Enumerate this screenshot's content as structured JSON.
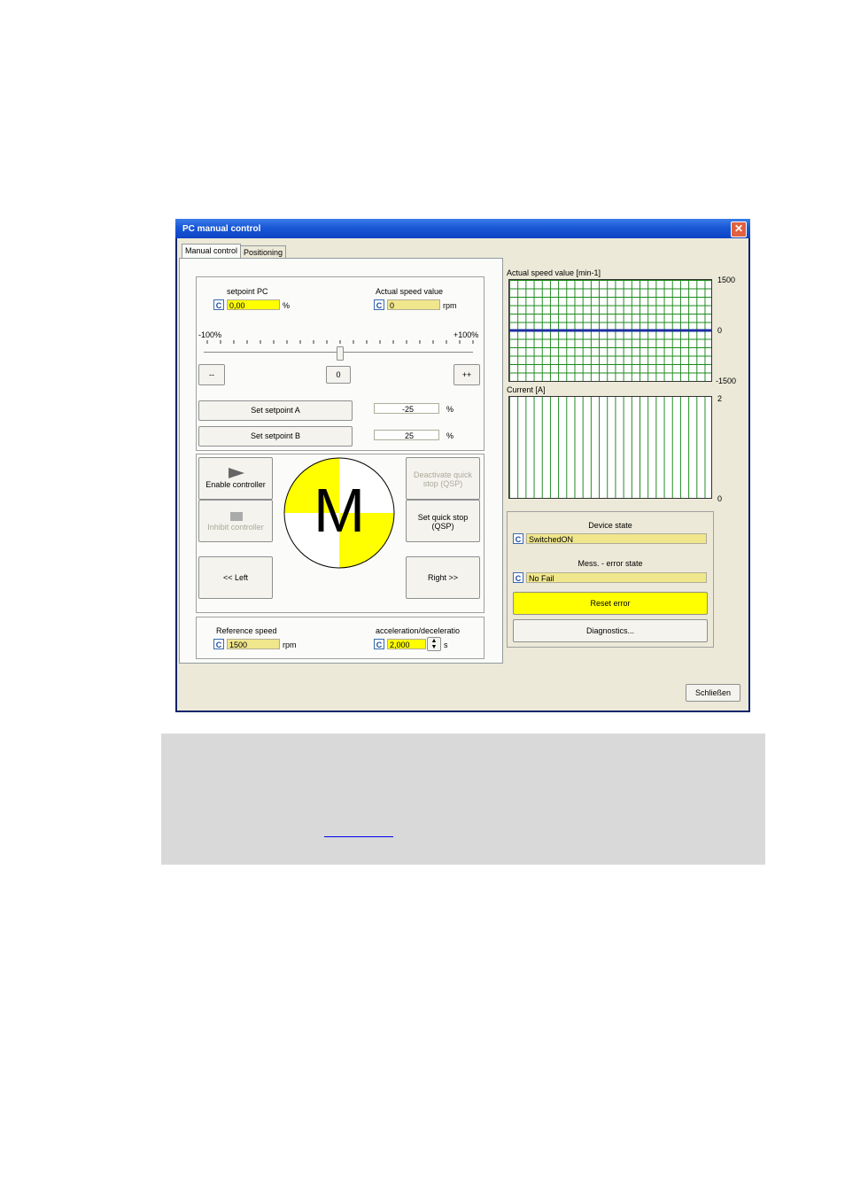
{
  "window": {
    "title": "PC manual control",
    "close": "✕"
  },
  "tabs": [
    {
      "label": "Manual control"
    },
    {
      "label": "Positioning"
    }
  ],
  "setpoint": {
    "label": "setpoint PC",
    "value": "0,00",
    "unit": "%",
    "actual_label": "Actual speed value",
    "actual_value": "0",
    "actual_unit": "rpm",
    "c": "C"
  },
  "slider": {
    "min_label": "-100%",
    "max_label": "+100%",
    "position_percent": 0
  },
  "step_buttons": {
    "minus": "--",
    "zero": "0",
    "plus": "++"
  },
  "set_setpoint_a": {
    "label": "Set setpoint A",
    "value": "-25",
    "unit": "%"
  },
  "set_setpoint_b": {
    "label": "Set setpoint B",
    "value": "25",
    "unit": "%"
  },
  "controls": {
    "enable": "Enable controller",
    "inhibit": "Inhibit controller",
    "deactivate_qsp": "Deactivate quick stop (QSP)",
    "set_qsp": "Set quick stop (QSP)",
    "left": "<< Left",
    "right": "Right >>",
    "motor_letter": "M"
  },
  "reference": {
    "speed_label": "Reference speed",
    "speed_value": "1500",
    "speed_unit": "rpm",
    "accel_label": "acceleration/deceleratio",
    "accel_value": "2,000",
    "accel_unit": "s"
  },
  "chart_speed": {
    "title": "Actual speed value [min-1]",
    "max": "1500",
    "mid": "0",
    "min": "-1500"
  },
  "chart_current": {
    "title": "Current [A]",
    "max": "2",
    "min": "0"
  },
  "device": {
    "state_label": "Device state",
    "state_value": "SwitchedON",
    "error_label": "Mess. - error state",
    "error_value": "No Fail",
    "reset": "Reset error",
    "diagnostics": "Diagnostics..."
  },
  "close_button": "Schließen",
  "colors": {
    "yellow": "#ffff00",
    "khaki": "#f0e68c",
    "grid": "#1b8a1b",
    "speed_line": "#1c2fa0"
  },
  "chart_data": [
    {
      "type": "line",
      "title": "Actual speed value [min-1]",
      "ylim": [
        -1500,
        1500
      ],
      "series": [
        {
          "values": [
            0,
            0
          ]
        }
      ]
    },
    {
      "type": "line",
      "title": "Current [A]",
      "ylim": [
        0,
        2
      ],
      "series": []
    }
  ]
}
